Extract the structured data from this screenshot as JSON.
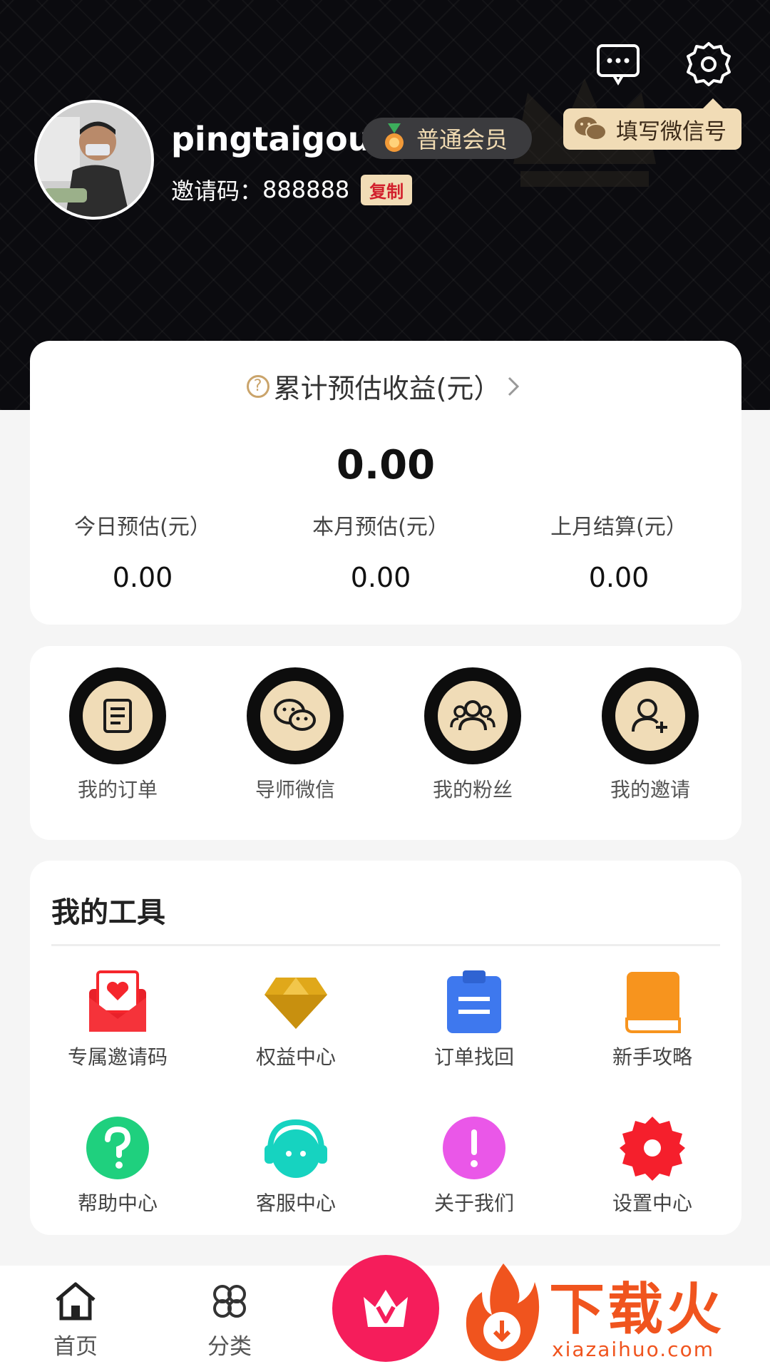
{
  "profile": {
    "username": "pingtaigou",
    "member_level": "普通会员",
    "invite_label": "邀请码：",
    "invite_code": "888888",
    "copy_label": "复制",
    "wechat_button": "填写微信号"
  },
  "earnings": {
    "title": "累计预估收益(元）",
    "total": "0.00",
    "stats": [
      {
        "label": "今日预估(元）",
        "value": "0.00"
      },
      {
        "label": "本月预估(元）",
        "value": "0.00"
      },
      {
        "label": "上月结算(元）",
        "value": "0.00"
      }
    ]
  },
  "quick_actions": [
    {
      "label": "我的订单",
      "icon": "document-icon"
    },
    {
      "label": "导师微信",
      "icon": "wechat-icon"
    },
    {
      "label": "我的粉丝",
      "icon": "group-icon"
    },
    {
      "label": "我的邀请",
      "icon": "add-user-icon"
    }
  ],
  "tools": {
    "title": "我的工具",
    "items": [
      {
        "label": "专属邀请码",
        "icon": "invite-envelope-icon",
        "color": "#f5262c"
      },
      {
        "label": "权益中心",
        "icon": "diamond-icon",
        "color": "#e0a81a"
      },
      {
        "label": "订单找回",
        "icon": "clipboard-icon",
        "color": "#3e78ee"
      },
      {
        "label": "新手攻略",
        "icon": "book-icon",
        "color": "#f7941e"
      },
      {
        "label": "帮助中心",
        "icon": "help-icon",
        "color": "#1fd07e"
      },
      {
        "label": "客服中心",
        "icon": "headset-icon",
        "color": "#16d3c0"
      },
      {
        "label": "关于我们",
        "icon": "info-icon",
        "color": "#ea57e8"
      },
      {
        "label": "设置中心",
        "icon": "gear-icon",
        "color": "#f51f2c"
      }
    ]
  },
  "tabbar": [
    {
      "label": "首页",
      "icon": "home-icon"
    },
    {
      "label": "分类",
      "icon": "category-icon"
    },
    {
      "label": "",
      "icon": "vip-crown-icon",
      "color": "#f51d5b"
    }
  ],
  "watermark": {
    "text": "下载火",
    "url": "xiazaihuo.com"
  },
  "colors": {
    "gold": "#f1dcb6",
    "dark": "#0b0b0f",
    "accent": "#f51d5b"
  }
}
